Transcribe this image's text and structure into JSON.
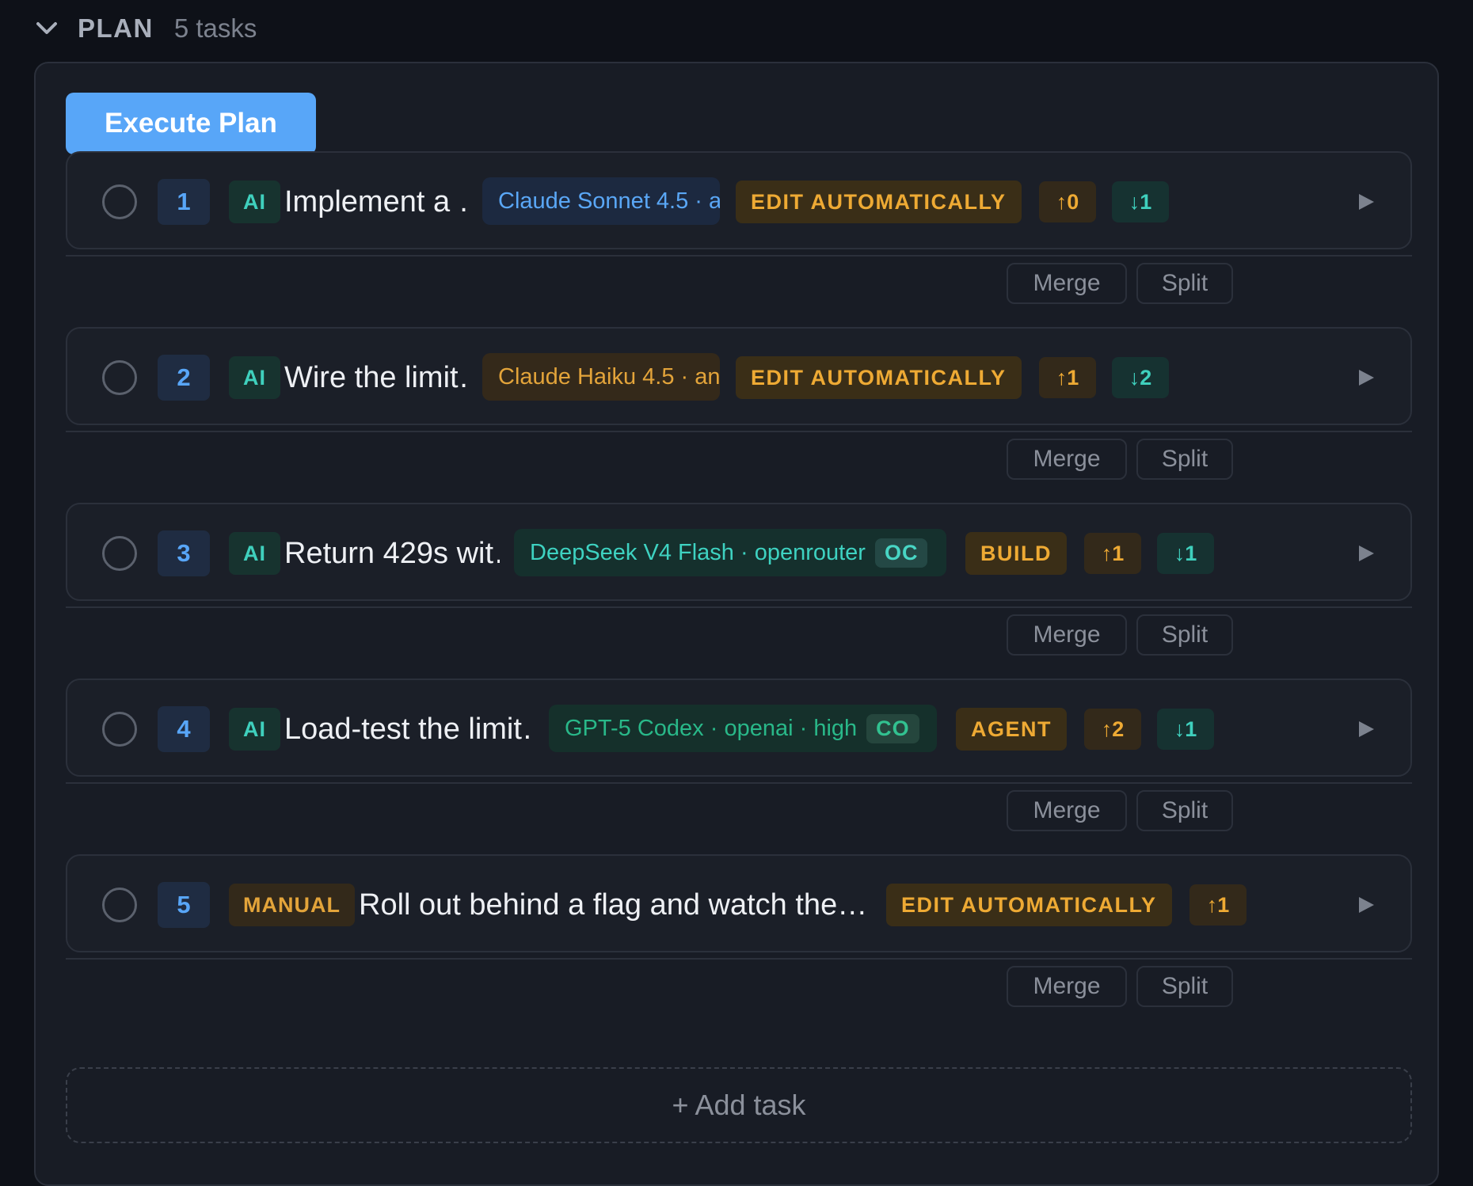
{
  "plan": {
    "title": "PLAN",
    "count": "5 tasks",
    "execute_label": "Execute Plan",
    "add_task_label": "+ Add task"
  },
  "tasks": [
    {
      "number": "1",
      "type": "AI",
      "title": "Implement a …",
      "model": "Claude Sonnet 4.5 · a…",
      "model_tag": "",
      "model_style": "blue",
      "mode": "EDIT AUTOMATICALLY",
      "deps_up": "↑0",
      "deps_down": "↓1",
      "merge_label": "Merge",
      "split_label": "Split"
    },
    {
      "number": "2",
      "type": "AI",
      "title": "Wire the limit…",
      "model": "Claude Haiku 4.5 · an…",
      "model_tag": "",
      "model_style": "amber",
      "mode": "EDIT AUTOMATICALLY",
      "deps_up": "↑1",
      "deps_down": "↓2",
      "merge_label": "Merge",
      "split_label": "Split"
    },
    {
      "number": "3",
      "type": "AI",
      "title": "Return 429s wit…",
      "model": "DeepSeek V4 Flash · openrouter",
      "model_tag": "OC",
      "model_style": "teal",
      "mode": "BUILD",
      "deps_up": "↑1",
      "deps_down": "↓1",
      "merge_label": "Merge",
      "split_label": "Split"
    },
    {
      "number": "4",
      "type": "AI",
      "title": "Load-test the limit…",
      "model": "GPT-5 Codex · openai · high",
      "model_tag": "CO",
      "model_style": "green",
      "mode": "AGENT",
      "deps_up": "↑2",
      "deps_down": "↓1",
      "merge_label": "Merge",
      "split_label": "Split"
    },
    {
      "number": "5",
      "type": "MANUAL",
      "title": "Roll out behind a flag and watch the…",
      "mode": "EDIT AUTOMATICALLY",
      "deps_up": "↑1",
      "merge_label": "Merge",
      "split_label": "Split"
    }
  ],
  "icons": {
    "collapse": "chevron-down-icon",
    "run": "play-icon",
    "status": "circle-checkbox-icon"
  },
  "colors": {
    "accent": "#58a6f8",
    "amber": "#eeaa34",
    "teal": "#3fd0bd",
    "green": "#29b889",
    "background": "#0e1118",
    "panel": "#181c25"
  }
}
